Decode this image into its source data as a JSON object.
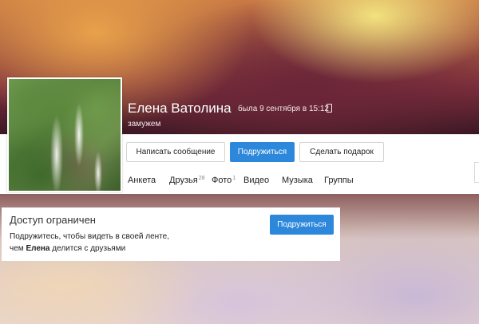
{
  "profile": {
    "name": "Елена Ватолина",
    "last_seen": "была 9 сентября в 15:12",
    "status": "замужем"
  },
  "actions": {
    "message_label": "Написать сообщение",
    "subscribe_label": "Подружиться",
    "gift_label": "Сделать подарок"
  },
  "nav": {
    "items": [
      {
        "label": "Анкета",
        "count": ""
      },
      {
        "label": "Друзья",
        "count": "28"
      },
      {
        "label": "Фото",
        "count": "1"
      },
      {
        "label": "Видео",
        "count": ""
      },
      {
        "label": "Музыка",
        "count": ""
      },
      {
        "label": "Группы",
        "count": ""
      }
    ]
  },
  "access": {
    "title": "Доступ ограничен",
    "line1": "Подружитесь, чтобы видеть в своей ленте,",
    "line2_prefix": "чем ",
    "line2_name": "Елена",
    "line2_suffix": " делится с друзьями",
    "button_label": "Подружиться"
  },
  "icons": {
    "phone": "mobile-phone-icon"
  },
  "colors": {
    "primary_button": "#2d88db"
  }
}
